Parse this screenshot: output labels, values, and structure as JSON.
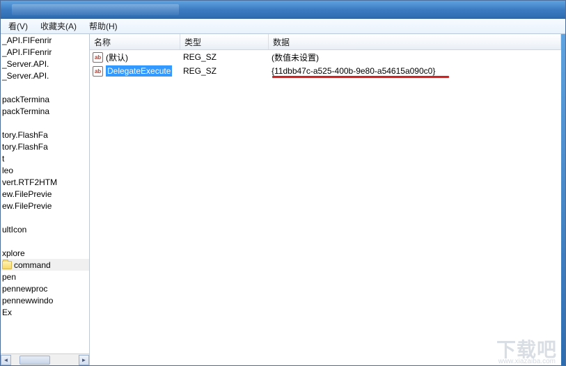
{
  "menu": {
    "view": "看(V)",
    "favorites": "收藏夹(A)",
    "help": "帮助(H)"
  },
  "tree": {
    "items": [
      "_API.FIFenrir",
      "_API.FIFenrir",
      "_Server.API.",
      "_Server.API.",
      "",
      "packTermina",
      "packTermina",
      "",
      "tory.FlashFa",
      "tory.FlashFa",
      "t",
      "leo",
      "vert.RTF2HTM",
      "ew.FilePrevie",
      "ew.FilePrevie",
      "",
      "ultIcon",
      "",
      "xplore",
      "command",
      "pen",
      "pennewproc",
      "pennewwindo",
      "Ex"
    ],
    "selected_index": 19
  },
  "columns": {
    "name": "名称",
    "type": "类型",
    "data": "数据"
  },
  "rows": [
    {
      "icon": "ab",
      "name": "(默认)",
      "type": "REG_SZ",
      "data": "(数值未设置)",
      "selected": false
    },
    {
      "icon": "ab",
      "name": "DelegateExecute",
      "type": "REG_SZ",
      "data": "{11dbb47c-a525-400b-9e80-a54615a090c0}",
      "selected": true
    }
  ],
  "watermark": {
    "main": "下载吧",
    "sub": "www.xiazaiba.com"
  }
}
